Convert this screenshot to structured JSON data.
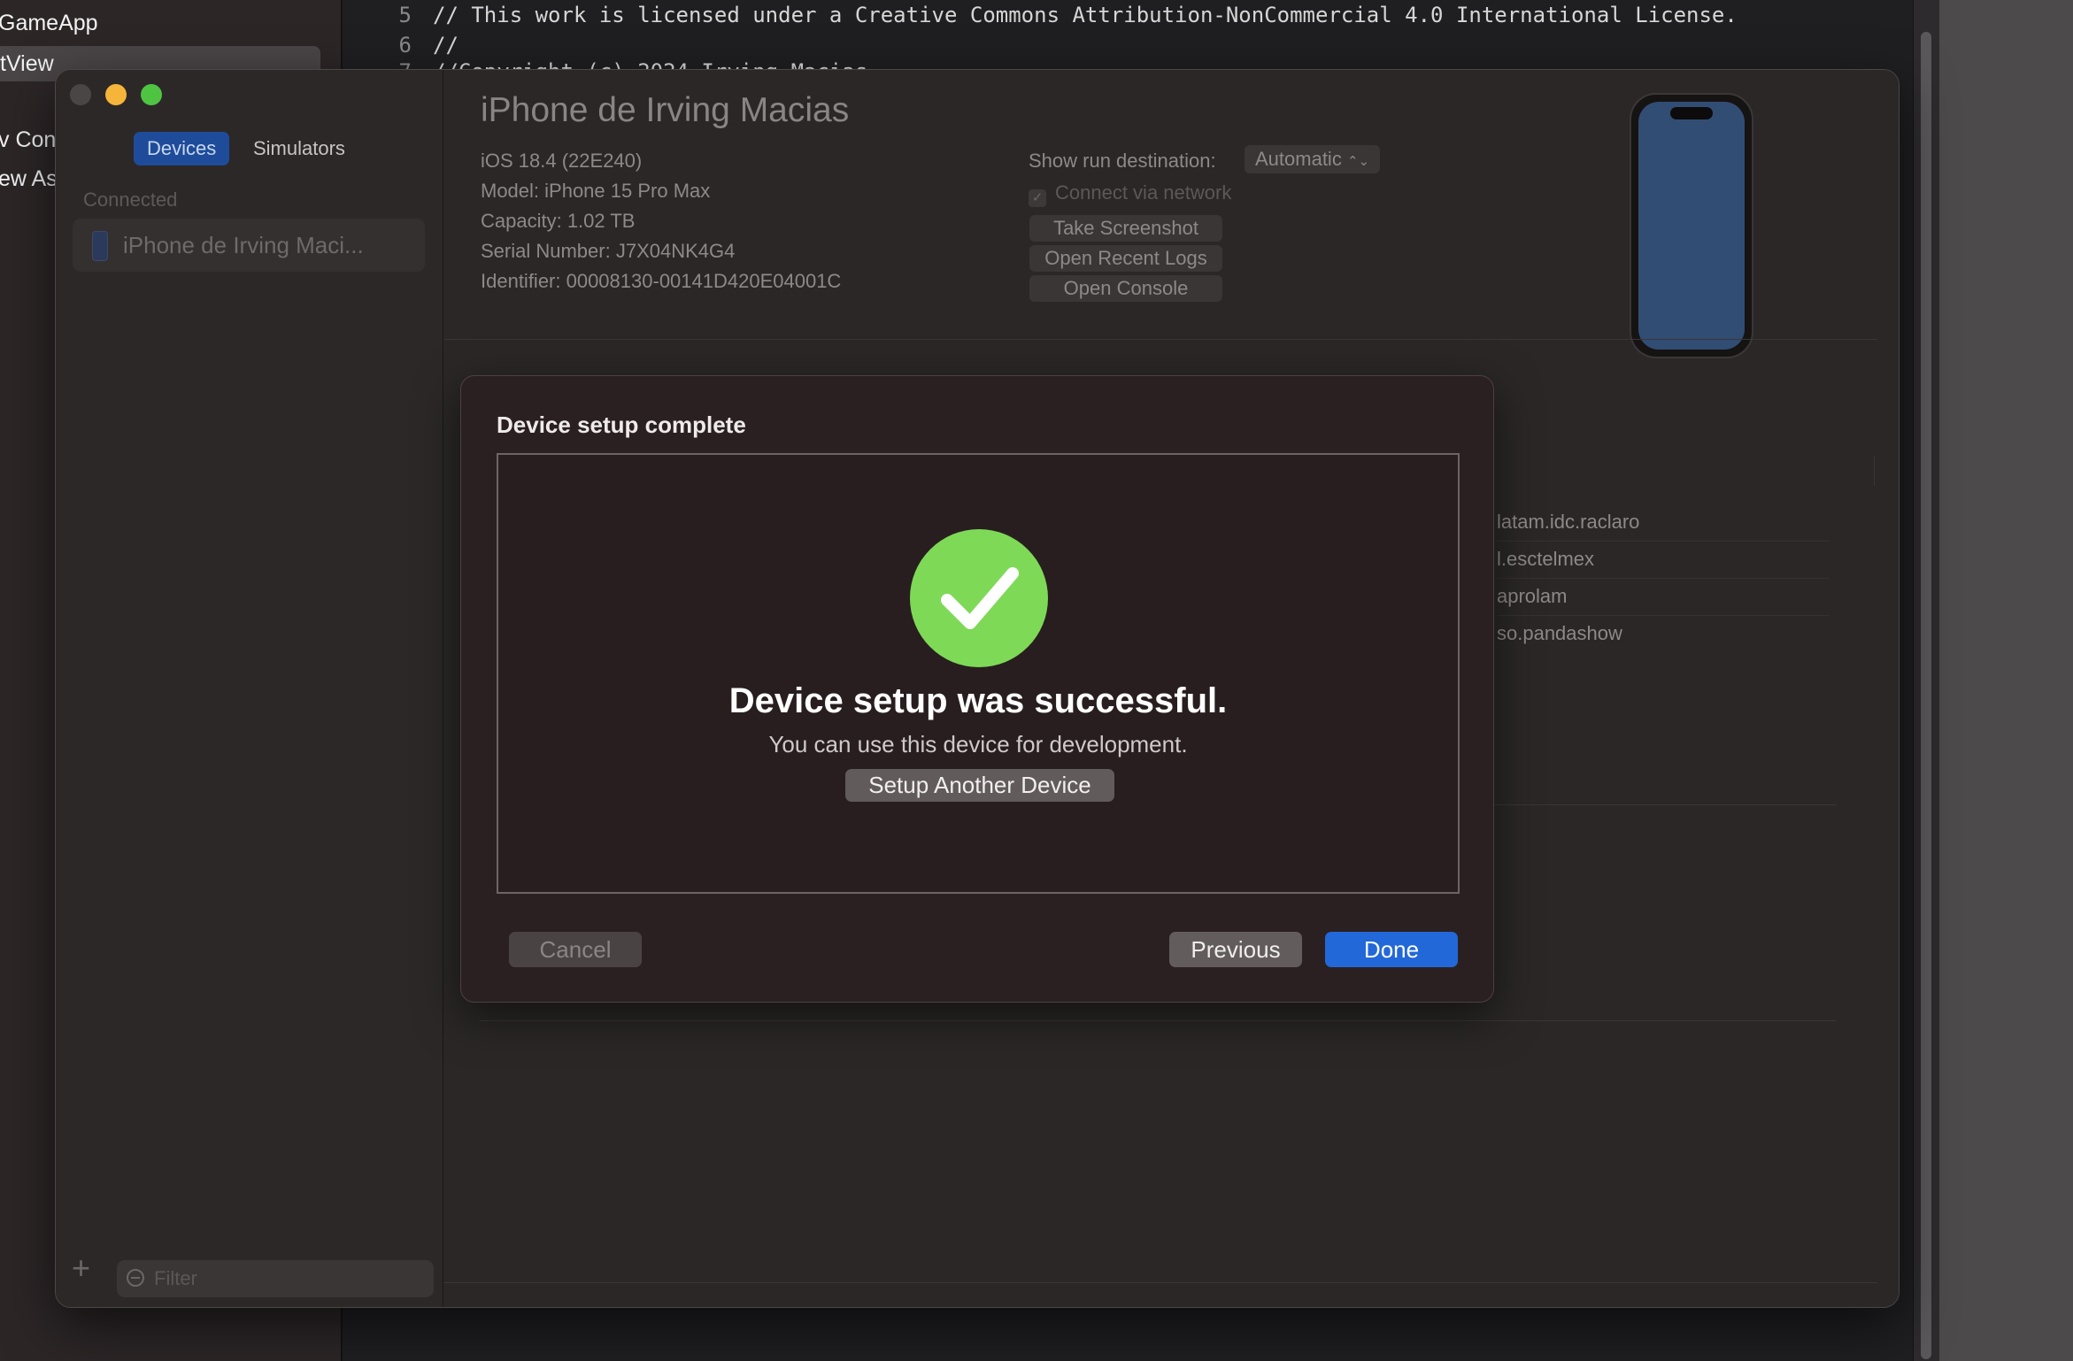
{
  "xcode": {
    "sidebar_items": [
      "GameApp",
      "tView",
      "v Con",
      "ew As"
    ],
    "code_lines": [
      {
        "num": "5",
        "text": "// This work is licensed under a Creative Commons Attribution-NonCommercial 4.0 International License."
      },
      {
        "num": "6",
        "text": "//"
      },
      {
        "num": "7",
        "text": "//Copyright (c) 2024 Irving Macias"
      }
    ]
  },
  "devices_window": {
    "segments": {
      "devices": "Devices",
      "simulators": "Simulators"
    },
    "group_label": "Connected",
    "device_item": "iPhone de Irving Maci...",
    "filter_placeholder": "Filter",
    "add_symbol": "+",
    "device": {
      "name": "iPhone de Irving Macias",
      "ios": "iOS 18.4 (22E240)",
      "model": "Model: iPhone 15 Pro Max",
      "capacity": "Capacity: 1.02 TB",
      "serial": "Serial Number: J7X04NK4G4",
      "identifier": "Identifier: 00008130-00141D420E04001C"
    },
    "run_destination_label": "Show run destination:",
    "run_destination_value": "Automatic",
    "select_arrows": "⌃⌄",
    "connect_via_network": "Connect via network",
    "checkmark_glyph": "✓",
    "actions": {
      "take_screenshot": "Take Screenshot",
      "open_recent_logs": "Open Recent Logs",
      "open_console": "Open Console"
    },
    "installed_apps": [
      "latam.idc.raclaro",
      "l.esctelmex",
      "aprolam",
      "so.pandashow"
    ]
  },
  "sheet": {
    "title": "Device setup complete",
    "headline": "Device setup was successful.",
    "subtext": "You can use this device for development.",
    "setup_another": "Setup Another Device",
    "cancel": "Cancel",
    "previous": "Previous",
    "done": "Done",
    "colors": {
      "success": "#7ed957",
      "primary_button": "#2368d8"
    }
  }
}
